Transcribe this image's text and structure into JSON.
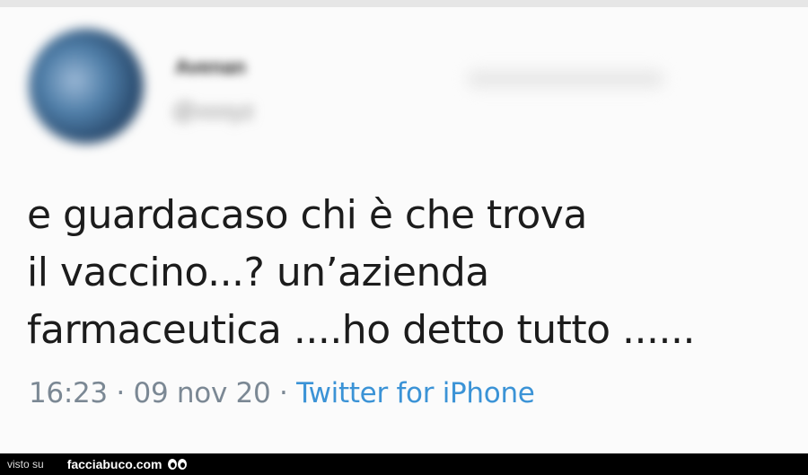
{
  "tweet": {
    "author_name": "Avenan",
    "author_handle": "@xxxyz",
    "text_lines": [
      "e guardacaso chi è che trova",
      "il vaccino...? un’azienda",
      "farmaceutica ....ho detto tutto ......"
    ],
    "time": "16:23",
    "date": "09 nov 20",
    "separator": "·",
    "source": "Twitter for iPhone"
  },
  "watermark": {
    "prefix": "visto su",
    "site": "facciabuco.com",
    "icon": "eyes-icon"
  }
}
